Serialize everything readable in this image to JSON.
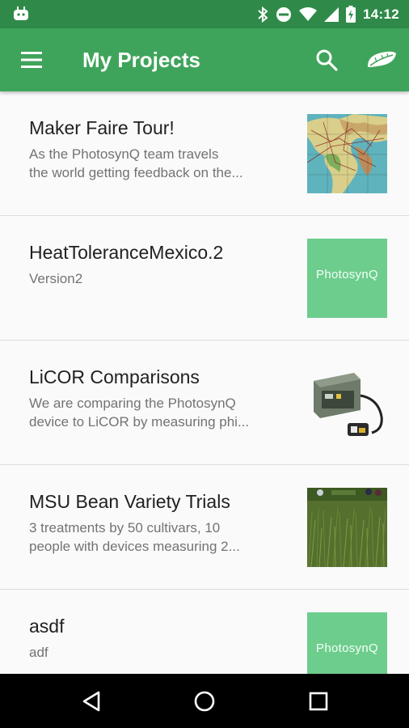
{
  "status_bar": {
    "time": "14:12",
    "icons": [
      "android-icon",
      "bluetooth-icon",
      "do-not-disturb-icon",
      "wifi-icon",
      "signal-icon",
      "battery-charging-icon"
    ]
  },
  "app_bar": {
    "title": "My Projects",
    "icons": [
      "menu-icon",
      "search-icon",
      "leaf-icon"
    ],
    "color": "#3fa45b",
    "status_color": "#2f8a49"
  },
  "projects": [
    {
      "name": "Maker Faire Tour!",
      "description_lines": [
        "As the PhotosynQ team travels",
        "the world getting feedback on the..."
      ],
      "thumbnail": "world-map-image"
    },
    {
      "name": "HeatToleranceMexico.2",
      "description_lines": [
        "Version2"
      ],
      "thumbnail": "photosynq-logo",
      "logo_text": "PhotosynQ"
    },
    {
      "name": "LiCOR Comparisons",
      "description_lines": [
        "We are comparing the PhotosynQ",
        "device to LiCOR by measuring phi..."
      ],
      "thumbnail": "licor-device-image"
    },
    {
      "name": "MSU Bean Variety Trials",
      "description_lines": [
        "3 treatments by 50 cultivars, 10",
        "people with devices measuring 2..."
      ],
      "thumbnail": "bean-field-image"
    },
    {
      "name": "asdf",
      "description_lines": [
        "adf"
      ],
      "thumbnail": "photosynq-logo",
      "logo_text": "PhotosynQ"
    }
  ],
  "nav_bar": {
    "icons": [
      "back-icon",
      "home-icon",
      "recents-icon"
    ]
  }
}
